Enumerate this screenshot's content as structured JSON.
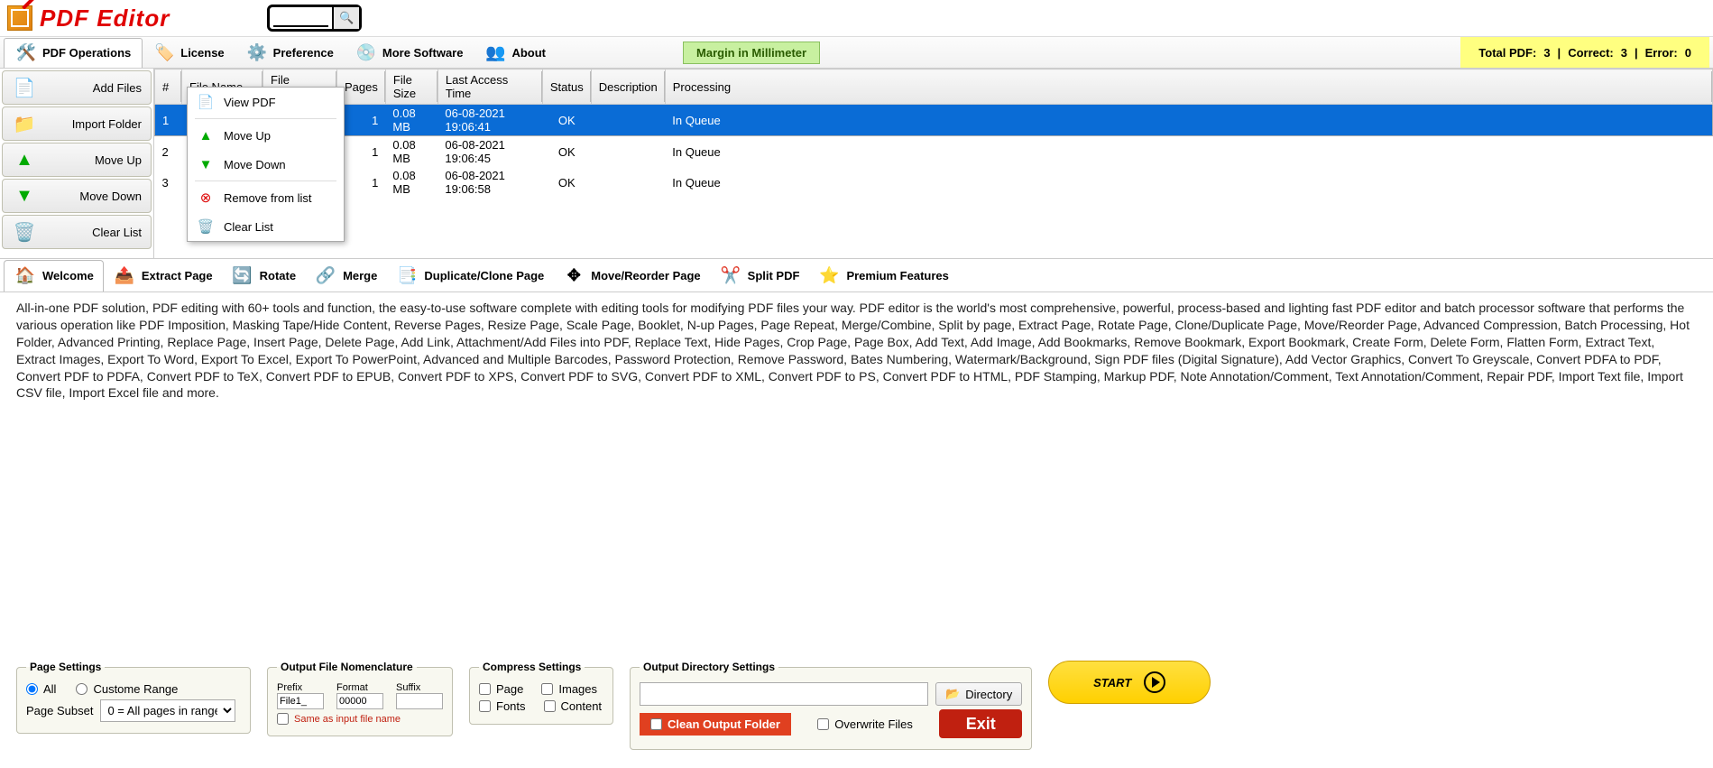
{
  "app": {
    "title": "PDF Editor",
    "search_placeholder": ""
  },
  "menu": {
    "pdf_ops": "PDF Operations",
    "license": "License",
    "preference": "Preference",
    "more_software": "More Software",
    "about": "About",
    "margin_badge": "Margin in Millimeter"
  },
  "status": {
    "total_label": "Total PDF:",
    "total": "3",
    "correct_label": "Correct:",
    "correct": "3",
    "error_label": "Error:",
    "error": "0"
  },
  "sidebar": {
    "add_files": "Add Files",
    "import_folder": "Import Folder",
    "move_up": "Move Up",
    "move_down": "Move Down",
    "clear_list": "Clear List"
  },
  "grid": {
    "headers": {
      "num": "#",
      "fname": "File Name",
      "fpwd": "File Password",
      "pages": "Pages",
      "fsize": "File Size",
      "lat": "Last Access Time",
      "status": "Status",
      "desc": "Description",
      "proc": "Processing"
    },
    "rows": [
      {
        "num": "1",
        "pages": "1",
        "fsize": "0.08 MB",
        "lat": "06-08-2021 19:06:41",
        "status": "OK",
        "proc": "In Queue"
      },
      {
        "num": "2",
        "pages": "1",
        "fsize": "0.08 MB",
        "lat": "06-08-2021 19:06:45",
        "status": "OK",
        "proc": "In Queue"
      },
      {
        "num": "3",
        "pages": "1",
        "fsize": "0.08 MB",
        "lat": "06-08-2021 19:06:58",
        "status": "OK",
        "proc": "In Queue"
      }
    ]
  },
  "context_menu": {
    "view_pdf": "View PDF",
    "move_up": "Move Up",
    "move_down": "Move Down",
    "remove": "Remove from list",
    "clear": "Clear List"
  },
  "tabs": {
    "welcome": "Welcome",
    "extract": "Extract Page",
    "rotate": "Rotate",
    "merge": "Merge",
    "duplicate": "Duplicate/Clone Page",
    "move": "Move/Reorder Page",
    "split": "Split PDF",
    "premium": "Premium Features"
  },
  "description": "All-in-one PDF solution, PDF editing with 60+ tools and function, the easy-to-use software complete with editing tools for modifying PDF files your way. PDF editor is the world's most comprehensive, powerful, process-based and lighting fast PDF editor and batch processor software that performs the various operation like PDF Imposition, Masking Tape/Hide Content, Reverse Pages, Resize Page, Scale Page, Booklet, N-up Pages, Page Repeat, Merge/Combine, Split by page, Extract Page, Rotate Page, Clone/Duplicate Page, Move/Reorder Page, Advanced Compression, Batch Processing, Hot Folder, Advanced Printing, Replace Page, Insert Page, Delete Page, Add Link, Attachment/Add Files into PDF, Replace Text, Hide Pages, Crop Page, Page Box, Add Text, Add Image, Add Bookmarks, Remove Bookmark, Export Bookmark, Create Form, Delete Form, Flatten Form, Extract Text, Extract Images, Export To Word, Export To Excel, Export To PowerPoint, Advanced and Multiple Barcodes, Password Protection, Remove Password, Bates Numbering,  Watermark/Background, Sign PDF files (Digital Signature), Add Vector Graphics, Convert To Greyscale, Convert PDFA to PDF, Convert PDF to PDFA, Convert PDF to TeX, Convert PDF to EPUB, Convert PDF to XPS, Convert PDF to SVG, Convert PDF to XML, Convert PDF to PS, Convert PDF to HTML, PDF Stamping, Markup PDF, Note Annotation/Comment, Text Annotation/Comment, Repair PDF, Import Text file, Import CSV file, Import Excel file and more.",
  "page_settings": {
    "legend": "Page Settings",
    "all": "All",
    "custom": "Custome Range",
    "subset_label": "Page Subset",
    "subset_value": "0 = All pages in range"
  },
  "nomenclature": {
    "legend": "Output File Nomenclature",
    "prefix_label": "Prefix",
    "format_label": "Format",
    "suffix_label": "Suffix",
    "prefix_value": "File1_",
    "format_value": "00000",
    "suffix_value": "",
    "same_as_input": "Same as input file name"
  },
  "compress": {
    "legend": "Compress Settings",
    "page": "Page",
    "images": "Images",
    "fonts": "Fonts",
    "content": "Content"
  },
  "output": {
    "legend": "Output Directory Settings",
    "directory_btn": "Directory",
    "clean_btn": "Clean Output Folder",
    "overwrite": "Overwrite Files",
    "exit": "Exit"
  },
  "start_btn": "START"
}
